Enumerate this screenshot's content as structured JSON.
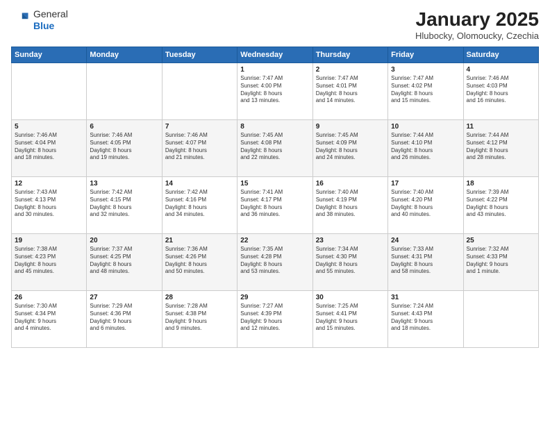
{
  "logo": {
    "general": "General",
    "blue": "Blue"
  },
  "header": {
    "title": "January 2025",
    "subtitle": "Hlubocky, Olomoucky, Czechia"
  },
  "days_of_week": [
    "Sunday",
    "Monday",
    "Tuesday",
    "Wednesday",
    "Thursday",
    "Friday",
    "Saturday"
  ],
  "weeks": [
    [
      {
        "day": "",
        "content": ""
      },
      {
        "day": "",
        "content": ""
      },
      {
        "day": "",
        "content": ""
      },
      {
        "day": "1",
        "content": "Sunrise: 7:47 AM\nSunset: 4:00 PM\nDaylight: 8 hours\nand 13 minutes."
      },
      {
        "day": "2",
        "content": "Sunrise: 7:47 AM\nSunset: 4:01 PM\nDaylight: 8 hours\nand 14 minutes."
      },
      {
        "day": "3",
        "content": "Sunrise: 7:47 AM\nSunset: 4:02 PM\nDaylight: 8 hours\nand 15 minutes."
      },
      {
        "day": "4",
        "content": "Sunrise: 7:46 AM\nSunset: 4:03 PM\nDaylight: 8 hours\nand 16 minutes."
      }
    ],
    [
      {
        "day": "5",
        "content": "Sunrise: 7:46 AM\nSunset: 4:04 PM\nDaylight: 8 hours\nand 18 minutes."
      },
      {
        "day": "6",
        "content": "Sunrise: 7:46 AM\nSunset: 4:05 PM\nDaylight: 8 hours\nand 19 minutes."
      },
      {
        "day": "7",
        "content": "Sunrise: 7:46 AM\nSunset: 4:07 PM\nDaylight: 8 hours\nand 21 minutes."
      },
      {
        "day": "8",
        "content": "Sunrise: 7:45 AM\nSunset: 4:08 PM\nDaylight: 8 hours\nand 22 minutes."
      },
      {
        "day": "9",
        "content": "Sunrise: 7:45 AM\nSunset: 4:09 PM\nDaylight: 8 hours\nand 24 minutes."
      },
      {
        "day": "10",
        "content": "Sunrise: 7:44 AM\nSunset: 4:10 PM\nDaylight: 8 hours\nand 26 minutes."
      },
      {
        "day": "11",
        "content": "Sunrise: 7:44 AM\nSunset: 4:12 PM\nDaylight: 8 hours\nand 28 minutes."
      }
    ],
    [
      {
        "day": "12",
        "content": "Sunrise: 7:43 AM\nSunset: 4:13 PM\nDaylight: 8 hours\nand 30 minutes."
      },
      {
        "day": "13",
        "content": "Sunrise: 7:42 AM\nSunset: 4:15 PM\nDaylight: 8 hours\nand 32 minutes."
      },
      {
        "day": "14",
        "content": "Sunrise: 7:42 AM\nSunset: 4:16 PM\nDaylight: 8 hours\nand 34 minutes."
      },
      {
        "day": "15",
        "content": "Sunrise: 7:41 AM\nSunset: 4:17 PM\nDaylight: 8 hours\nand 36 minutes."
      },
      {
        "day": "16",
        "content": "Sunrise: 7:40 AM\nSunset: 4:19 PM\nDaylight: 8 hours\nand 38 minutes."
      },
      {
        "day": "17",
        "content": "Sunrise: 7:40 AM\nSunset: 4:20 PM\nDaylight: 8 hours\nand 40 minutes."
      },
      {
        "day": "18",
        "content": "Sunrise: 7:39 AM\nSunset: 4:22 PM\nDaylight: 8 hours\nand 43 minutes."
      }
    ],
    [
      {
        "day": "19",
        "content": "Sunrise: 7:38 AM\nSunset: 4:23 PM\nDaylight: 8 hours\nand 45 minutes."
      },
      {
        "day": "20",
        "content": "Sunrise: 7:37 AM\nSunset: 4:25 PM\nDaylight: 8 hours\nand 48 minutes."
      },
      {
        "day": "21",
        "content": "Sunrise: 7:36 AM\nSunset: 4:26 PM\nDaylight: 8 hours\nand 50 minutes."
      },
      {
        "day": "22",
        "content": "Sunrise: 7:35 AM\nSunset: 4:28 PM\nDaylight: 8 hours\nand 53 minutes."
      },
      {
        "day": "23",
        "content": "Sunrise: 7:34 AM\nSunset: 4:30 PM\nDaylight: 8 hours\nand 55 minutes."
      },
      {
        "day": "24",
        "content": "Sunrise: 7:33 AM\nSunset: 4:31 PM\nDaylight: 8 hours\nand 58 minutes."
      },
      {
        "day": "25",
        "content": "Sunrise: 7:32 AM\nSunset: 4:33 PM\nDaylight: 9 hours\nand 1 minute."
      }
    ],
    [
      {
        "day": "26",
        "content": "Sunrise: 7:30 AM\nSunset: 4:34 PM\nDaylight: 9 hours\nand 4 minutes."
      },
      {
        "day": "27",
        "content": "Sunrise: 7:29 AM\nSunset: 4:36 PM\nDaylight: 9 hours\nand 6 minutes."
      },
      {
        "day": "28",
        "content": "Sunrise: 7:28 AM\nSunset: 4:38 PM\nDaylight: 9 hours\nand 9 minutes."
      },
      {
        "day": "29",
        "content": "Sunrise: 7:27 AM\nSunset: 4:39 PM\nDaylight: 9 hours\nand 12 minutes."
      },
      {
        "day": "30",
        "content": "Sunrise: 7:25 AM\nSunset: 4:41 PM\nDaylight: 9 hours\nand 15 minutes."
      },
      {
        "day": "31",
        "content": "Sunrise: 7:24 AM\nSunset: 4:43 PM\nDaylight: 9 hours\nand 18 minutes."
      },
      {
        "day": "",
        "content": ""
      }
    ]
  ]
}
